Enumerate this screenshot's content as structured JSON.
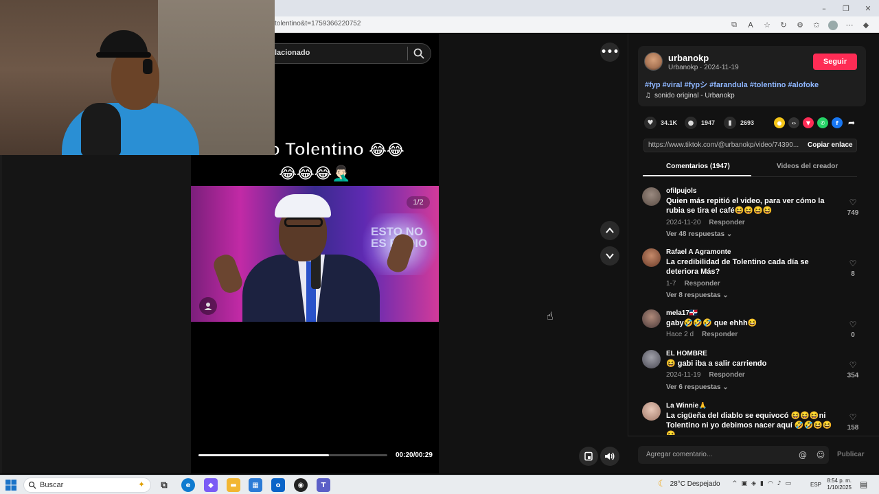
{
  "browser": {
    "url": "tolentino&t=1759366220752"
  },
  "video": {
    "search_placeholder": "lacionado",
    "caption_text": "Asi no Tolentino",
    "caption_emoji_line1": "😂😂",
    "caption_emoji_line2": "😂😂😂🤦🏻‍♂️",
    "slide_counter": "1/2",
    "studio_text": "ESTO NO ES RADIO",
    "timecode": "00:20/00:29",
    "progress_fraction": 0.69
  },
  "post": {
    "author_name": "urbanokp",
    "author_sub": "Urbanokp · 2024-11-19",
    "follow_label": "Seguir",
    "hashtags": "#fyp #viral #fypシ #farandula #tolentino #alofoke",
    "sound": "sonido original - Urbanokp",
    "likes": "34.1K",
    "comments_count": "1947",
    "saves": "2693",
    "link": "https://www.tiktok.com/@urbanokp/video/74390...",
    "copy_link_label": "Copiar enlace"
  },
  "tabs": {
    "comments": "Comentarios (1947)",
    "creator_videos": "Videos del creador"
  },
  "comments": [
    {
      "user": "ofilpujols",
      "text": "Quien más repitió el video, para ver cómo la rubia se tira el café😆😆😆😆",
      "date": "2024-11-20",
      "reply": "Responder",
      "likes": "749",
      "replies": "Ver 48 respuestas ⌄"
    },
    {
      "user": "Rafael A Agramonte",
      "text": "La credibilidad de Tolentino cada día se deteriora Más?",
      "date": "1-7",
      "reply": "Responder",
      "likes": "8",
      "replies": "Ver 8 respuestas ⌄"
    },
    {
      "user": "mela17🇩🇴",
      "text": "gaby🤣🤣🤣 que ehhh😆",
      "date": "Hace 2 d",
      "reply": "Responder",
      "likes": "0",
      "replies": ""
    },
    {
      "user": "EL HOMBRE",
      "text": "😆 gabi iba a salir carriendo",
      "date": "2024-11-19",
      "reply": "Responder",
      "likes": "354",
      "replies": "Ver 6 respuestas ⌄"
    },
    {
      "user": "La Winnie🙏",
      "text": "La cigüeña del diablo se equivocó 😆😆😆ni Tolentino ni yo debimos nacer aquí 🤣🤣😆😆😆",
      "date": "",
      "reply": "",
      "likes": "158",
      "replies": ""
    }
  ],
  "comment_box": {
    "placeholder": "Agregar comentario...",
    "publish_label": "Publicar"
  },
  "taskbar": {
    "search_label": "Buscar",
    "weather": "28°C  Despejado",
    "language": "ESP",
    "time": "8:54 p. m.",
    "date": "1/10/2025"
  },
  "colors": {
    "follow": "#fe2c55",
    "hashtag": "#8fb7ff"
  }
}
